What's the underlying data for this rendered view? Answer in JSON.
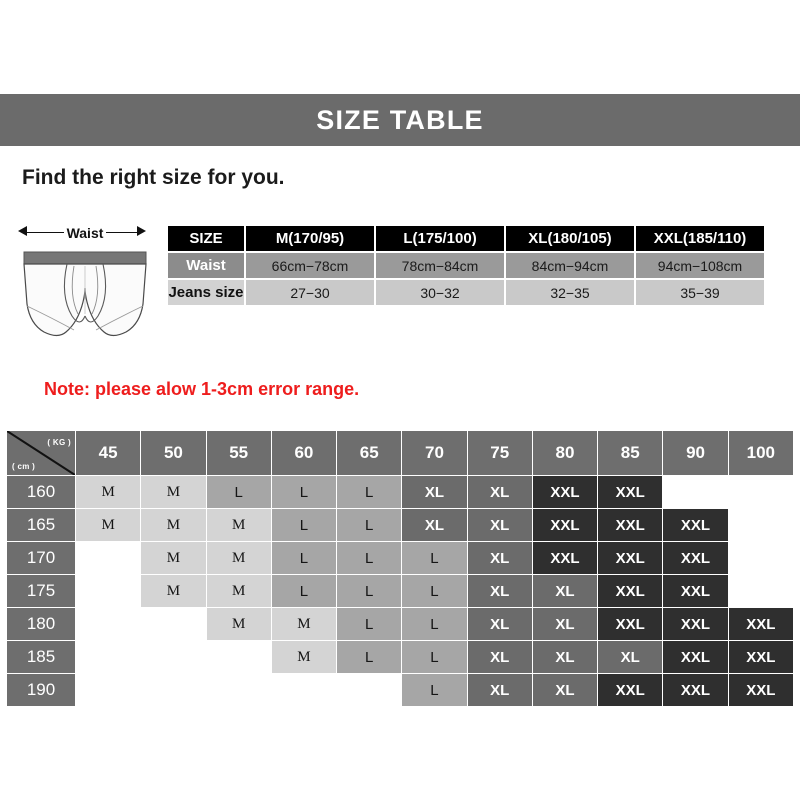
{
  "banner": {
    "title": "SIZE TABLE"
  },
  "subtitle": "Find the right size for you.",
  "illustration": {
    "waist_label": "Waist",
    "icon": "boxer-brief-illustration"
  },
  "size_table": {
    "headers": [
      "SIZE",
      "M(170/95)",
      "L(175/100)",
      "XL(180/105)",
      "XXL(185/110)"
    ],
    "rows": [
      {
        "label": "Waist",
        "values": [
          "66cm−78cm",
          "78cm−84cm",
          "84cm−94cm",
          "94cm−108cm"
        ]
      },
      {
        "label": "Jeans size",
        "values": [
          "27−30",
          "30−32",
          "32−35",
          "35−39"
        ]
      }
    ]
  },
  "note": "Note: please alow 1-3cm error range.",
  "grid": {
    "corner": {
      "weight_unit": "( KG )",
      "height_unit": "( cm )"
    },
    "weights": [
      "45",
      "50",
      "55",
      "60",
      "65",
      "70",
      "75",
      "80",
      "85",
      "90",
      "100"
    ],
    "heights": [
      "160",
      "165",
      "170",
      "175",
      "180",
      "185",
      "190"
    ],
    "rows": [
      {
        "height": "160",
        "cells": [
          "M",
          "M",
          "L",
          "L",
          "L",
          "XL",
          "XL",
          "XXL",
          "XXL",
          "",
          ""
        ]
      },
      {
        "height": "165",
        "cells": [
          "M",
          "M",
          "M",
          "L",
          "L",
          "XL",
          "XL",
          "XXL",
          "XXL",
          "XXL",
          ""
        ]
      },
      {
        "height": "170",
        "cells": [
          "",
          "M",
          "M",
          "L",
          "L",
          "L",
          "XL",
          "XXL",
          "XXL",
          "XXL",
          ""
        ]
      },
      {
        "height": "175",
        "cells": [
          "",
          "M",
          "M",
          "L",
          "L",
          "L",
          "XL",
          "XL",
          "XXL",
          "XXL",
          ""
        ]
      },
      {
        "height": "180",
        "cells": [
          "",
          "",
          "M",
          "M",
          "L",
          "L",
          "XL",
          "XL",
          "XXL",
          "XXL",
          "XXL"
        ]
      },
      {
        "height": "185",
        "cells": [
          "",
          "",
          "",
          "M",
          "L",
          "L",
          "XL",
          "XL",
          "XL",
          "XXL",
          "XXL"
        ]
      },
      {
        "height": "190",
        "cells": [
          "",
          "",
          "",
          "",
          "",
          "L",
          "XL",
          "XL",
          "XXL",
          "XXL",
          "XXL"
        ]
      }
    ]
  },
  "colors": {
    "banner_bg": "#6b6b6b",
    "note_text": "#ee1d1d",
    "size_M": "#d4d4d4",
    "size_L": "#a6a6a6",
    "size_XL": "#6b6b6b",
    "size_XXL": "#2f2f2f",
    "grid_header": "#6e6e6e"
  }
}
